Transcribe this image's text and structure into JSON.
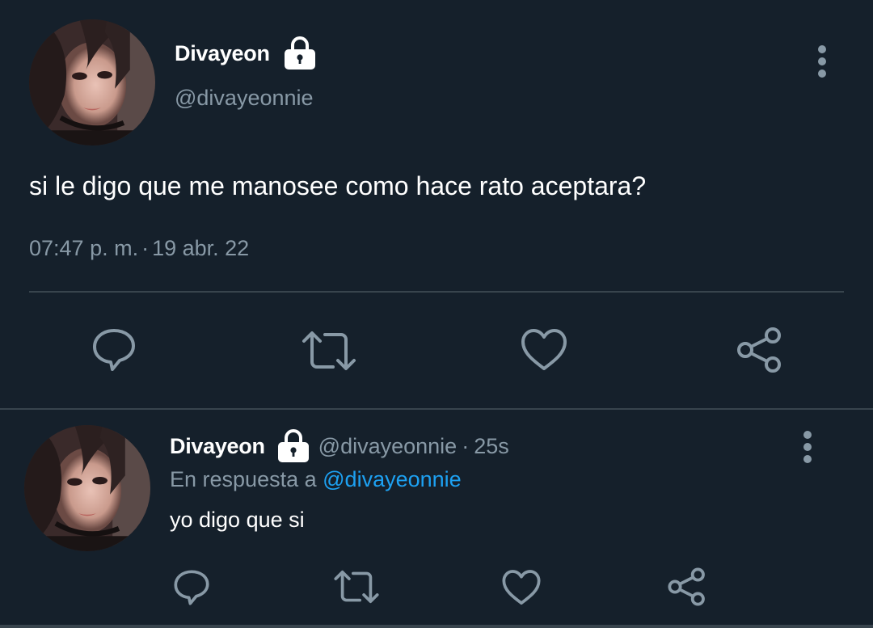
{
  "main_tweet": {
    "display_name": "Divayeon",
    "handle": "@divayeonnie",
    "text": "si le digo que me manosee como hace rato aceptara?",
    "time": "07:47 p. m.",
    "separator": "·",
    "date": "19 abr. 22",
    "actions": [
      "reply-icon",
      "retweet-icon",
      "like-icon",
      "share-icon"
    ]
  },
  "reply": {
    "display_name": "Divayeon",
    "handle": "@divayeonnie",
    "separator": "·",
    "age": "25s",
    "reply_prefix": "En respuesta a",
    "reply_mention": "@divayeonnie",
    "text": "yo digo que si",
    "actions": [
      "reply-icon",
      "retweet-icon",
      "like-icon",
      "share-icon"
    ]
  },
  "colors": {
    "background": "#15202b",
    "secondary_text": "#8899a6",
    "link": "#1da1f2",
    "divider": "#38444d",
    "icon": "#8899a6"
  }
}
